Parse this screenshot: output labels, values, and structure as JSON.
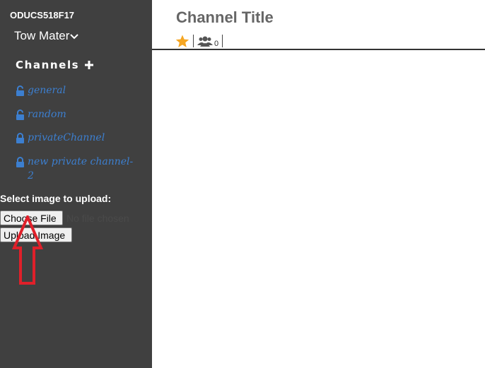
{
  "sidebar": {
    "team_name": "ODUCS518F17",
    "user_name": "Tow Mater",
    "channels_heading": "Channels",
    "channels": [
      {
        "name": "general",
        "lock": "unlocked-lock-icon"
      },
      {
        "name": "random",
        "lock": "unlocked-lock-icon"
      },
      {
        "name": "privateChannel",
        "lock": "locked-lock-icon"
      },
      {
        "name": "new private channel-2",
        "lock": "locked-lock-icon"
      }
    ],
    "upload": {
      "label": "Select image to upload:",
      "choose_file_label": "Choose File",
      "no_file_text": "No file chosen",
      "upload_button_label": "Upload Image"
    }
  },
  "header": {
    "title": "Channel Title",
    "member_count": "0"
  },
  "colors": {
    "sidebar_bg": "#404040",
    "channel_link": "#3c7fd0",
    "star": "#f5a623",
    "annotation_arrow": "#e0202a"
  }
}
